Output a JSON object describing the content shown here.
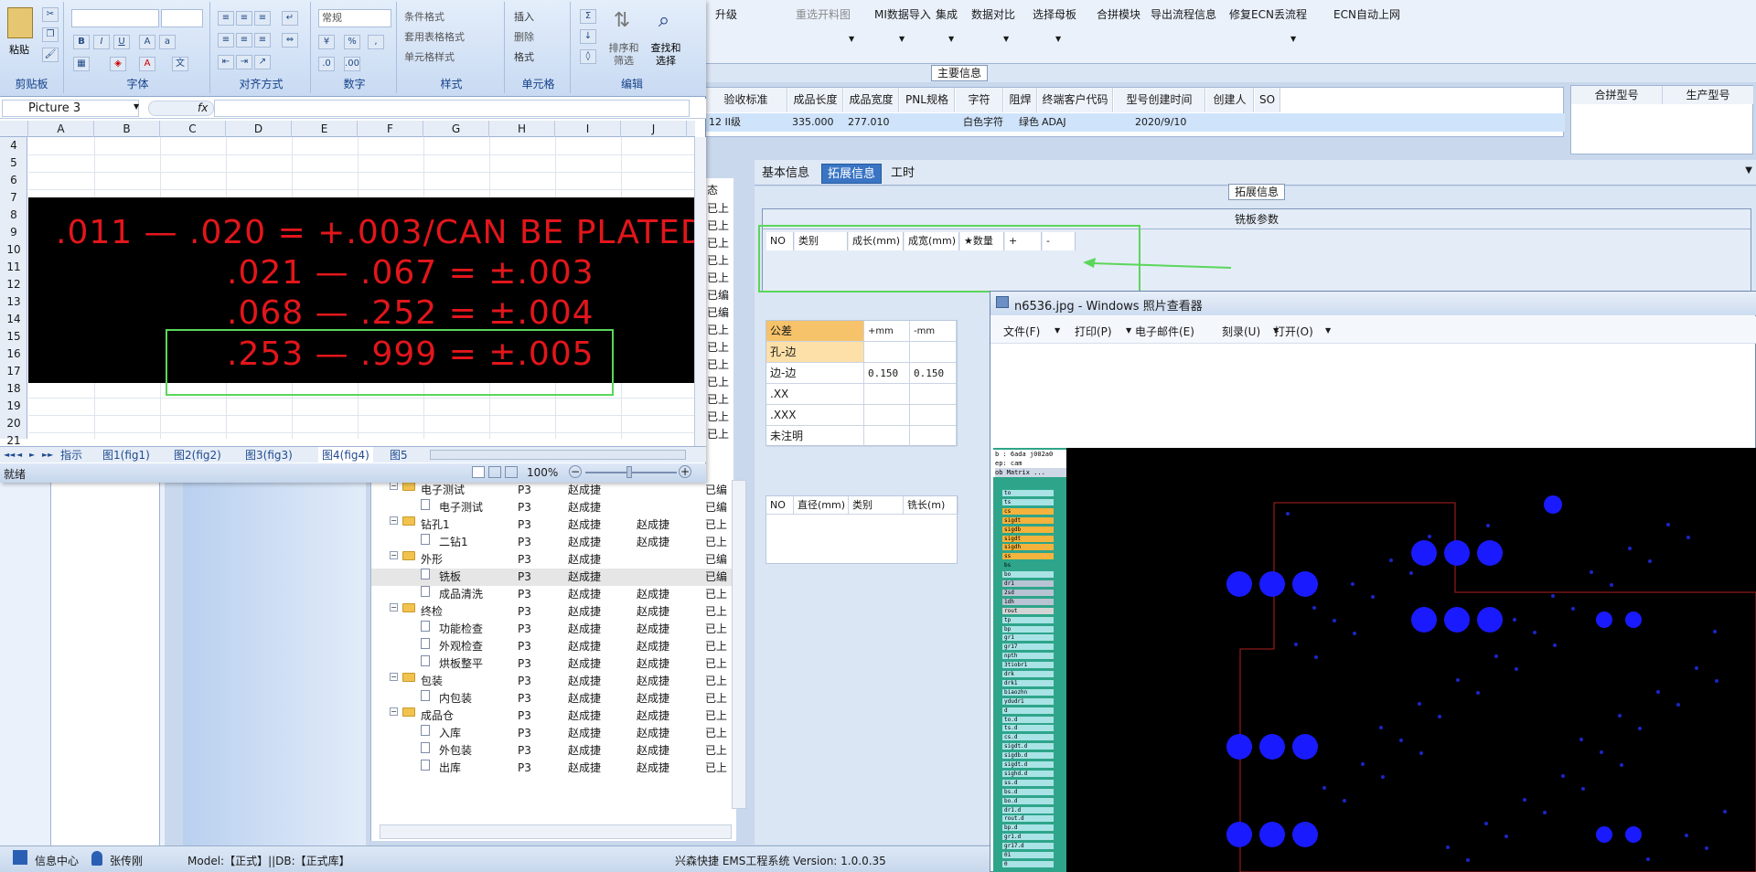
{
  "top_menu": {
    "items": [
      {
        "label": "升级",
        "disabled": false
      },
      {
        "label": "重选开料图",
        "disabled": true
      },
      {
        "label": "MI数据导入",
        "disabled": false
      },
      {
        "label": "集成",
        "disabled": false
      },
      {
        "label": "数据对比",
        "disabled": false
      },
      {
        "label": "选择母板",
        "disabled": false
      },
      {
        "label": "合拼模块",
        "disabled": false
      },
      {
        "label": "导出流程信息",
        "disabled": false
      },
      {
        "label": "修复ECN丢流程",
        "disabled": false
      },
      {
        "label": "ECN自动上网",
        "disabled": false
      }
    ]
  },
  "main_info": {
    "section_title": "主要信息",
    "columns": [
      "验收标准",
      "成品长度",
      "成品宽度",
      "PNL规格",
      "字符",
      "阻焊",
      "终端客户代码",
      "型号创建时间",
      "创建人",
      "SO"
    ],
    "row": [
      "12 II级",
      "335.000",
      "277.010",
      "",
      "白色字符",
      "绿色",
      "ADAJ",
      "2020/9/10",
      "",
      ""
    ],
    "side_columns": [
      "合拼型号",
      "生产型号"
    ]
  },
  "detail_tabs": [
    "基本信息",
    "拓展信息",
    "工时"
  ],
  "active_tab": "拓展信息",
  "ext_section_title": "拓展信息",
  "mill_params": {
    "title": "铣板参数",
    "columns": [
      "NO",
      "类别",
      "成长(mm)",
      "成宽(mm)",
      "★数量",
      "+",
      "-"
    ]
  },
  "tolerance_table": {
    "header": [
      "公差",
      "+mm",
      "-mm"
    ],
    "rows": [
      [
        "孔-边",
        "",
        ""
      ],
      [
        "边-边",
        "0.150",
        "0.150"
      ],
      [
        ".XX",
        "",
        ""
      ],
      [
        ".XXX",
        "",
        ""
      ],
      [
        "未注明",
        "",
        ""
      ]
    ]
  },
  "drill_table": {
    "columns": [
      "NO",
      "直径(mm)",
      "类别",
      "铣长(m)"
    ]
  },
  "tree": {
    "header_partial": [
      "态"
    ],
    "rows": [
      {
        "level": 0,
        "type": "folder",
        "label": "电子测试",
        "a": "P3",
        "b": "赵成捷",
        "c": "",
        "d": "已编"
      },
      {
        "level": 1,
        "type": "doc",
        "label": "电子测试",
        "a": "P3",
        "b": "赵成捷",
        "c": "",
        "d": "已编"
      },
      {
        "level": 0,
        "type": "folder",
        "label": "钻孔1",
        "a": "P3",
        "b": "赵成捷",
        "c": "赵成捷",
        "d": "已上"
      },
      {
        "level": 1,
        "type": "doc",
        "label": "二钻1",
        "a": "P3",
        "b": "赵成捷",
        "c": "赵成捷",
        "d": "已上"
      },
      {
        "level": 0,
        "type": "folder",
        "label": "外形",
        "a": "P3",
        "b": "赵成捷",
        "c": "",
        "d": "已编"
      },
      {
        "level": 1,
        "type": "doc",
        "label": "铣板",
        "a": "P3",
        "b": "赵成捷",
        "c": "",
        "d": "已编",
        "selected": true
      },
      {
        "level": 1,
        "type": "doc",
        "label": "成品清洗",
        "a": "P3",
        "b": "赵成捷",
        "c": "赵成捷",
        "d": "已上"
      },
      {
        "level": 0,
        "type": "folder",
        "label": "终检",
        "a": "P3",
        "b": "赵成捷",
        "c": "赵成捷",
        "d": "已上"
      },
      {
        "level": 1,
        "type": "doc",
        "label": "功能检查",
        "a": "P3",
        "b": "赵成捷",
        "c": "赵成捷",
        "d": "已上"
      },
      {
        "level": 1,
        "type": "doc",
        "label": "外观检查",
        "a": "P3",
        "b": "赵成捷",
        "c": "赵成捷",
        "d": "已上"
      },
      {
        "level": 1,
        "type": "doc",
        "label": "烘板整平",
        "a": "P3",
        "b": "赵成捷",
        "c": "赵成捷",
        "d": "已上"
      },
      {
        "level": 0,
        "type": "folder",
        "label": "包装",
        "a": "P3",
        "b": "赵成捷",
        "c": "赵成捷",
        "d": "已上"
      },
      {
        "level": 1,
        "type": "doc",
        "label": "内包装",
        "a": "P3",
        "b": "赵成捷",
        "c": "赵成捷",
        "d": "已上"
      },
      {
        "level": 0,
        "type": "folder",
        "label": "成品仓",
        "a": "P3",
        "b": "赵成捷",
        "c": "赵成捷",
        "d": "已上"
      },
      {
        "level": 1,
        "type": "doc",
        "label": "入库",
        "a": "P3",
        "b": "赵成捷",
        "c": "赵成捷",
        "d": "已上"
      },
      {
        "level": 1,
        "type": "doc",
        "label": "外包装",
        "a": "P3",
        "b": "赵成捷",
        "c": "赵成捷",
        "d": "已上"
      },
      {
        "level": 1,
        "type": "doc",
        "label": "出库",
        "a": "P3",
        "b": "赵成捷",
        "c": "赵成捷",
        "d": "已上"
      }
    ],
    "right_status_above": [
      "已上",
      "已上",
      "已上",
      "已上",
      "已上",
      "已编",
      "已编",
      "已上",
      "已上",
      "已上",
      "已上",
      "已上",
      "已上",
      "已上"
    ]
  },
  "status_bar": {
    "info_center": "信息中心",
    "user": "张传刚",
    "model_db": "Model:【正式】||DB:【正式库】",
    "app": "兴森快捷 EMS工程系统 Version: 1.0.0.35"
  },
  "excel": {
    "ribbon": {
      "paste": "粘贴",
      "groups": [
        "剪贴板",
        "字体",
        "对齐方式",
        "数字",
        "样式",
        "单元格",
        "编辑"
      ],
      "number_format": "常规",
      "style_items": [
        "条件格式",
        "套用表格格式",
        "单元格样式"
      ],
      "cell_items": [
        "插入",
        "删除",
        "格式"
      ],
      "edit_items": [
        "排序和\n筛选",
        "查找和\n选择"
      ]
    },
    "name_box": "Picture 3",
    "fx": "fx",
    "columns": [
      "A",
      "B",
      "C",
      "D",
      "E",
      "F",
      "G",
      "H",
      "I",
      "J"
    ],
    "rows": [
      "4",
      "5",
      "6",
      "7",
      "8",
      "9",
      "10",
      "11",
      "12",
      "13",
      "14",
      "15",
      "16",
      "17",
      "18",
      "19",
      "20",
      "21"
    ],
    "picture_lines": [
      ".011  —  .020  =  +.003/CAN BE PLATED",
      ".021  —  .067  = ±.003",
      ".068  —  .252  = ±.004",
      ".253  —  .999  = ±.005"
    ],
    "sheet_tabs": [
      "指示",
      "图1(fig1)",
      "图2(fig2)",
      "图3(fig3)",
      "图4(fig4)",
      "图5"
    ],
    "status": "就绪",
    "zoom": "100%"
  },
  "viewer": {
    "title": "n6536.jpg - Windows 照片查看器",
    "menu": [
      "文件(F)",
      "打印(P)",
      "电子邮件(E)",
      "刻录(U)",
      "打开(O)"
    ],
    "side_header": [
      "b : 6ada j002a0",
      "ep: cam",
      "ob Matrix ..."
    ],
    "layers": [
      "to",
      "ts",
      "cs",
      "sigdt",
      "sigdb",
      "sigdt",
      "sigdh",
      "ss",
      "bs",
      "bo",
      "dr1",
      "2sd",
      "1dh",
      "rout",
      "tp",
      "bp",
      "gr1",
      "gr17",
      "npth",
      "3tiobr1",
      "drk",
      "drk1",
      "biaozhn",
      "ydudr1",
      "d",
      "to.d",
      "ts.d",
      "cs.d",
      "sigdt.d",
      "sigdb.d",
      "sigdt.d",
      "sighd.d",
      "ss.d",
      "bs.d",
      "bo.d",
      "dr1.d",
      "rout.d",
      "bp.d",
      "gr1.d",
      "gr17.d",
      "01",
      "0"
    ]
  }
}
